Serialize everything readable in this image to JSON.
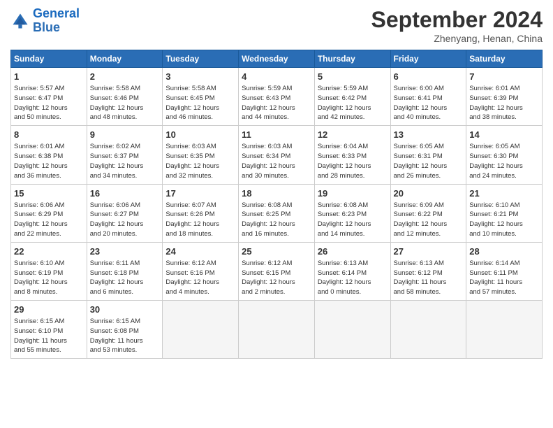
{
  "header": {
    "logo_line1": "General",
    "logo_line2": "Blue",
    "month": "September 2024",
    "location": "Zhenyang, Henan, China"
  },
  "days_of_week": [
    "Sunday",
    "Monday",
    "Tuesday",
    "Wednesday",
    "Thursday",
    "Friday",
    "Saturday"
  ],
  "weeks": [
    [
      {
        "day": 1,
        "lines": [
          "Sunrise: 5:57 AM",
          "Sunset: 6:47 PM",
          "Daylight: 12 hours",
          "and 50 minutes."
        ]
      },
      {
        "day": 2,
        "lines": [
          "Sunrise: 5:58 AM",
          "Sunset: 6:46 PM",
          "Daylight: 12 hours",
          "and 48 minutes."
        ]
      },
      {
        "day": 3,
        "lines": [
          "Sunrise: 5:58 AM",
          "Sunset: 6:45 PM",
          "Daylight: 12 hours",
          "and 46 minutes."
        ]
      },
      {
        "day": 4,
        "lines": [
          "Sunrise: 5:59 AM",
          "Sunset: 6:43 PM",
          "Daylight: 12 hours",
          "and 44 minutes."
        ]
      },
      {
        "day": 5,
        "lines": [
          "Sunrise: 5:59 AM",
          "Sunset: 6:42 PM",
          "Daylight: 12 hours",
          "and 42 minutes."
        ]
      },
      {
        "day": 6,
        "lines": [
          "Sunrise: 6:00 AM",
          "Sunset: 6:41 PM",
          "Daylight: 12 hours",
          "and 40 minutes."
        ]
      },
      {
        "day": 7,
        "lines": [
          "Sunrise: 6:01 AM",
          "Sunset: 6:39 PM",
          "Daylight: 12 hours",
          "and 38 minutes."
        ]
      }
    ],
    [
      {
        "day": 8,
        "lines": [
          "Sunrise: 6:01 AM",
          "Sunset: 6:38 PM",
          "Daylight: 12 hours",
          "and 36 minutes."
        ]
      },
      {
        "day": 9,
        "lines": [
          "Sunrise: 6:02 AM",
          "Sunset: 6:37 PM",
          "Daylight: 12 hours",
          "and 34 minutes."
        ]
      },
      {
        "day": 10,
        "lines": [
          "Sunrise: 6:03 AM",
          "Sunset: 6:35 PM",
          "Daylight: 12 hours",
          "and 32 minutes."
        ]
      },
      {
        "day": 11,
        "lines": [
          "Sunrise: 6:03 AM",
          "Sunset: 6:34 PM",
          "Daylight: 12 hours",
          "and 30 minutes."
        ]
      },
      {
        "day": 12,
        "lines": [
          "Sunrise: 6:04 AM",
          "Sunset: 6:33 PM",
          "Daylight: 12 hours",
          "and 28 minutes."
        ]
      },
      {
        "day": 13,
        "lines": [
          "Sunrise: 6:05 AM",
          "Sunset: 6:31 PM",
          "Daylight: 12 hours",
          "and 26 minutes."
        ]
      },
      {
        "day": 14,
        "lines": [
          "Sunrise: 6:05 AM",
          "Sunset: 6:30 PM",
          "Daylight: 12 hours",
          "and 24 minutes."
        ]
      }
    ],
    [
      {
        "day": 15,
        "lines": [
          "Sunrise: 6:06 AM",
          "Sunset: 6:29 PM",
          "Daylight: 12 hours",
          "and 22 minutes."
        ]
      },
      {
        "day": 16,
        "lines": [
          "Sunrise: 6:06 AM",
          "Sunset: 6:27 PM",
          "Daylight: 12 hours",
          "and 20 minutes."
        ]
      },
      {
        "day": 17,
        "lines": [
          "Sunrise: 6:07 AM",
          "Sunset: 6:26 PM",
          "Daylight: 12 hours",
          "and 18 minutes."
        ]
      },
      {
        "day": 18,
        "lines": [
          "Sunrise: 6:08 AM",
          "Sunset: 6:25 PM",
          "Daylight: 12 hours",
          "and 16 minutes."
        ]
      },
      {
        "day": 19,
        "lines": [
          "Sunrise: 6:08 AM",
          "Sunset: 6:23 PM",
          "Daylight: 12 hours",
          "and 14 minutes."
        ]
      },
      {
        "day": 20,
        "lines": [
          "Sunrise: 6:09 AM",
          "Sunset: 6:22 PM",
          "Daylight: 12 hours",
          "and 12 minutes."
        ]
      },
      {
        "day": 21,
        "lines": [
          "Sunrise: 6:10 AM",
          "Sunset: 6:21 PM",
          "Daylight: 12 hours",
          "and 10 minutes."
        ]
      }
    ],
    [
      {
        "day": 22,
        "lines": [
          "Sunrise: 6:10 AM",
          "Sunset: 6:19 PM",
          "Daylight: 12 hours",
          "and 8 minutes."
        ]
      },
      {
        "day": 23,
        "lines": [
          "Sunrise: 6:11 AM",
          "Sunset: 6:18 PM",
          "Daylight: 12 hours",
          "and 6 minutes."
        ]
      },
      {
        "day": 24,
        "lines": [
          "Sunrise: 6:12 AM",
          "Sunset: 6:16 PM",
          "Daylight: 12 hours",
          "and 4 minutes."
        ]
      },
      {
        "day": 25,
        "lines": [
          "Sunrise: 6:12 AM",
          "Sunset: 6:15 PM",
          "Daylight: 12 hours",
          "and 2 minutes."
        ]
      },
      {
        "day": 26,
        "lines": [
          "Sunrise: 6:13 AM",
          "Sunset: 6:14 PM",
          "Daylight: 12 hours",
          "and 0 minutes."
        ]
      },
      {
        "day": 27,
        "lines": [
          "Sunrise: 6:13 AM",
          "Sunset: 6:12 PM",
          "Daylight: 11 hours",
          "and 58 minutes."
        ]
      },
      {
        "day": 28,
        "lines": [
          "Sunrise: 6:14 AM",
          "Sunset: 6:11 PM",
          "Daylight: 11 hours",
          "and 57 minutes."
        ]
      }
    ],
    [
      {
        "day": 29,
        "lines": [
          "Sunrise: 6:15 AM",
          "Sunset: 6:10 PM",
          "Daylight: 11 hours",
          "and 55 minutes."
        ]
      },
      {
        "day": 30,
        "lines": [
          "Sunrise: 6:15 AM",
          "Sunset: 6:08 PM",
          "Daylight: 11 hours",
          "and 53 minutes."
        ]
      },
      null,
      null,
      null,
      null,
      null
    ]
  ]
}
